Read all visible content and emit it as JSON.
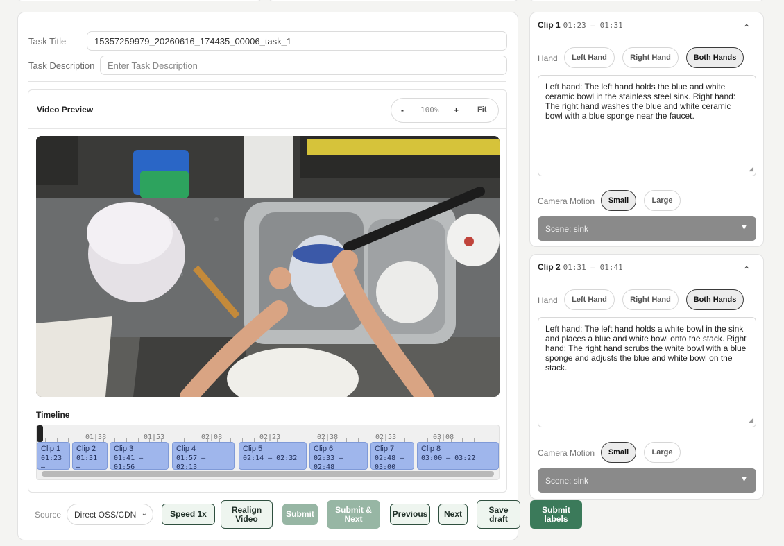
{
  "task": {
    "title_label": "Task Title",
    "title_value": "15357259979_20260616_174435_00006_task_1",
    "description_label": "Task Description",
    "description_placeholder": "Enter Task Description"
  },
  "preview": {
    "title": "Video Preview",
    "zoom_out": "-",
    "zoom_level": "100%",
    "zoom_in": "+",
    "fit": "Fit"
  },
  "timeline": {
    "label": "Timeline",
    "ticks": [
      "01|38",
      "01|53",
      "02|08",
      "02|23",
      "02|38",
      "02|53",
      "03|08"
    ],
    "clips": [
      {
        "name": "Clip 1",
        "range": "01:23\n–"
      },
      {
        "name": "Clip 2",
        "range": "01:31\n–"
      },
      {
        "name": "Clip 3",
        "range": "01:41 –\n01:56"
      },
      {
        "name": "Clip 4",
        "range": "01:57 – 02:13"
      },
      {
        "name": "Clip 5",
        "range": "02:14 – 02:32"
      },
      {
        "name": "Clip 6",
        "range": "02:33 –\n02:48"
      },
      {
        "name": "Clip 7",
        "range": "02:48 –\n03:00"
      },
      {
        "name": "Clip 8",
        "range": "03:00 – 03:22"
      }
    ]
  },
  "controls": {
    "source_label": "Source",
    "source_value": "Direct OSS/CDN",
    "speed": "Speed 1x",
    "realign": "Realign\nVideo",
    "submit": "Submit",
    "submit_next": "Submit &\nNext",
    "previous": "Previous",
    "next": "Next",
    "save_draft": "Save\ndraft",
    "submit_labels": "Submit\nlabels"
  },
  "clips": [
    {
      "title": "Clip 1",
      "range": "01:23 – 01:31",
      "hand_label": "Hand",
      "hand_options": [
        "Left Hand",
        "Right Hand",
        "Both Hands"
      ],
      "hand_selected": "Both Hands",
      "description": "Left hand: The left hand holds the blue and white ceramic bowl in the stainless steel sink. Right hand: The right hand washes the blue and white ceramic bowl with a blue sponge near the faucet.",
      "camera_label": "Camera Motion",
      "camera_options": [
        "Small",
        "Large"
      ],
      "camera_selected": "Small",
      "scene": "Scene:  sink"
    },
    {
      "title": "Clip 2",
      "range": "01:31 – 01:41",
      "hand_label": "Hand",
      "hand_options": [
        "Left Hand",
        "Right Hand",
        "Both Hands"
      ],
      "hand_selected": "Both Hands",
      "description": "Left hand: The left hand holds a white bowl in the sink and places a blue and white bowl onto the stack. Right hand: The right hand scrubs the white bowl with a blue sponge and adjusts the blue and white bowl on the stack.",
      "camera_label": "Camera Motion",
      "camera_options": [
        "Small",
        "Large"
      ],
      "camera_selected": "Small",
      "scene": "Scene:  sink"
    }
  ],
  "colors": {
    "accent_green": "#3b7a5a",
    "clip_blue": "#9fb6ec",
    "scene_gray": "#8a8a8a"
  }
}
